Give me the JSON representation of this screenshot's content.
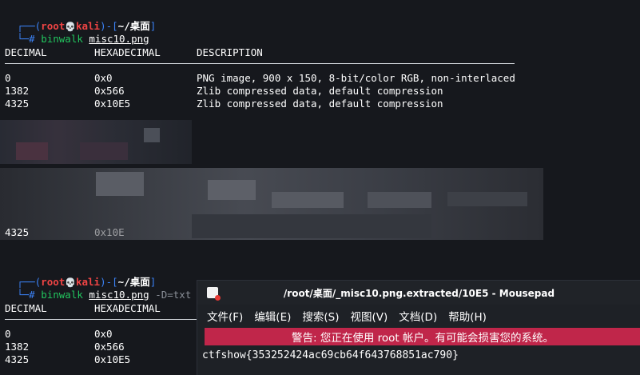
{
  "terminal": {
    "prompt1": {
      "user": "root",
      "skull": "💀",
      "host": "kali",
      "path": "~/桌面",
      "symbol": "#",
      "cmd": "binwalk",
      "arg": "misc10.png",
      "opt": ""
    },
    "prompt2": {
      "user": "root",
      "skull": "💀",
      "host": "kali",
      "path": "~/桌面",
      "symbol": "#",
      "cmd": "binwalk",
      "arg": "misc10.png",
      "opt": "-D=txt"
    },
    "headers": [
      "DECIMAL",
      "HEXADECIMAL",
      "DESCRIPTION"
    ],
    "rows1": [
      {
        "dec": "0",
        "hex": "0x0",
        "desc": "PNG image, 900 x 150, 8-bit/color RGB, non-interlaced"
      },
      {
        "dec": "1382",
        "hex": "0x566",
        "desc": "Zlib compressed data, default compression"
      },
      {
        "dec": "4325",
        "hex": "0x10E5",
        "desc": "Zlib compressed data, default compression"
      }
    ],
    "partial_row": {
      "dec": "4325",
      "hex": "0x10E"
    },
    "rows2": [
      {
        "dec": "0",
        "hex": "0x0"
      },
      {
        "dec": "1382",
        "hex": "0x566"
      },
      {
        "dec": "4325",
        "hex": "0x10E5"
      }
    ]
  },
  "mousepad": {
    "title": "/root/桌面/_misc10.png.extracted/10E5 - Mousepad",
    "menu": [
      "文件(F)",
      "编辑(E)",
      "搜索(S)",
      "视图(V)",
      "文档(D)",
      "帮助(H)"
    ],
    "warning": "警告: 您正在使用 root 帐户。有可能会损害您的系统。",
    "content": "ctfshow{353252424ac69cb64f643768851ac790}"
  },
  "colors": {
    "background": "#16181d",
    "prompt_frame": "#3b82f6",
    "user": "#ef4444",
    "command": "#22c55e",
    "warning_bar": "#c0264a"
  }
}
